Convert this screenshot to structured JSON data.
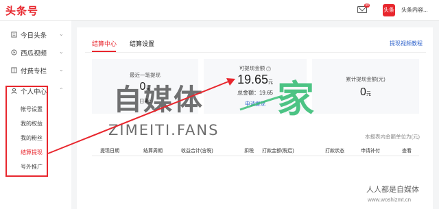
{
  "header": {
    "logo": "头条号",
    "notification_count": "99",
    "avatar_text": "头条",
    "account_name": "头条内容..."
  },
  "sidebar": {
    "items": [
      {
        "label": "今日头条",
        "icon": "toutiao-icon"
      },
      {
        "label": "西瓜视频",
        "icon": "video-icon"
      },
      {
        "label": "付费专栏",
        "icon": "column-icon"
      },
      {
        "label": "个人中心",
        "icon": "user-icon"
      }
    ],
    "sub_items": [
      {
        "label": "帐号设置"
      },
      {
        "label": "我的权益"
      },
      {
        "label": "我的粉丝"
      },
      {
        "label": "结算提现",
        "active": true
      },
      {
        "label": "号外推广"
      }
    ]
  },
  "main": {
    "tabs": [
      {
        "label": "结算中心",
        "active": true
      },
      {
        "label": "结算设置",
        "active": false
      }
    ],
    "tutorial_link": "提现视频教程",
    "cards": {
      "last_withdraw": {
        "title": "最近一笔提现",
        "amount": "0",
        "unit": "元",
        "date_label": "日期:"
      },
      "withdrawable": {
        "title": "可提现金额",
        "amount": "19.65",
        "unit": "元",
        "total_label": "总金额：",
        "total_value": "19.65",
        "action": "申请提现"
      },
      "accumulated": {
        "title": "累计提现金额(元)",
        "amount": "0",
        "unit": "元"
      }
    },
    "unit_note": "本报表内金额单位为(元)",
    "table": {
      "columns": [
        "提现日期",
        "结算周期",
        "收益合计(含税)",
        "扣税",
        "打款金额(税后)",
        "打款状态",
        "申请补付",
        "查看"
      ]
    }
  },
  "watermark": {
    "main_text": "自媒体",
    "accent_char": "家",
    "url": "ZIMEITI.FANS",
    "corner_title": "人人都是自媒体",
    "corner_url": "www.woshizmt.cn"
  },
  "colors": {
    "brand_red": "#e8262d",
    "link_blue": "#3366cc",
    "watermark_green": "#2eba6e"
  }
}
